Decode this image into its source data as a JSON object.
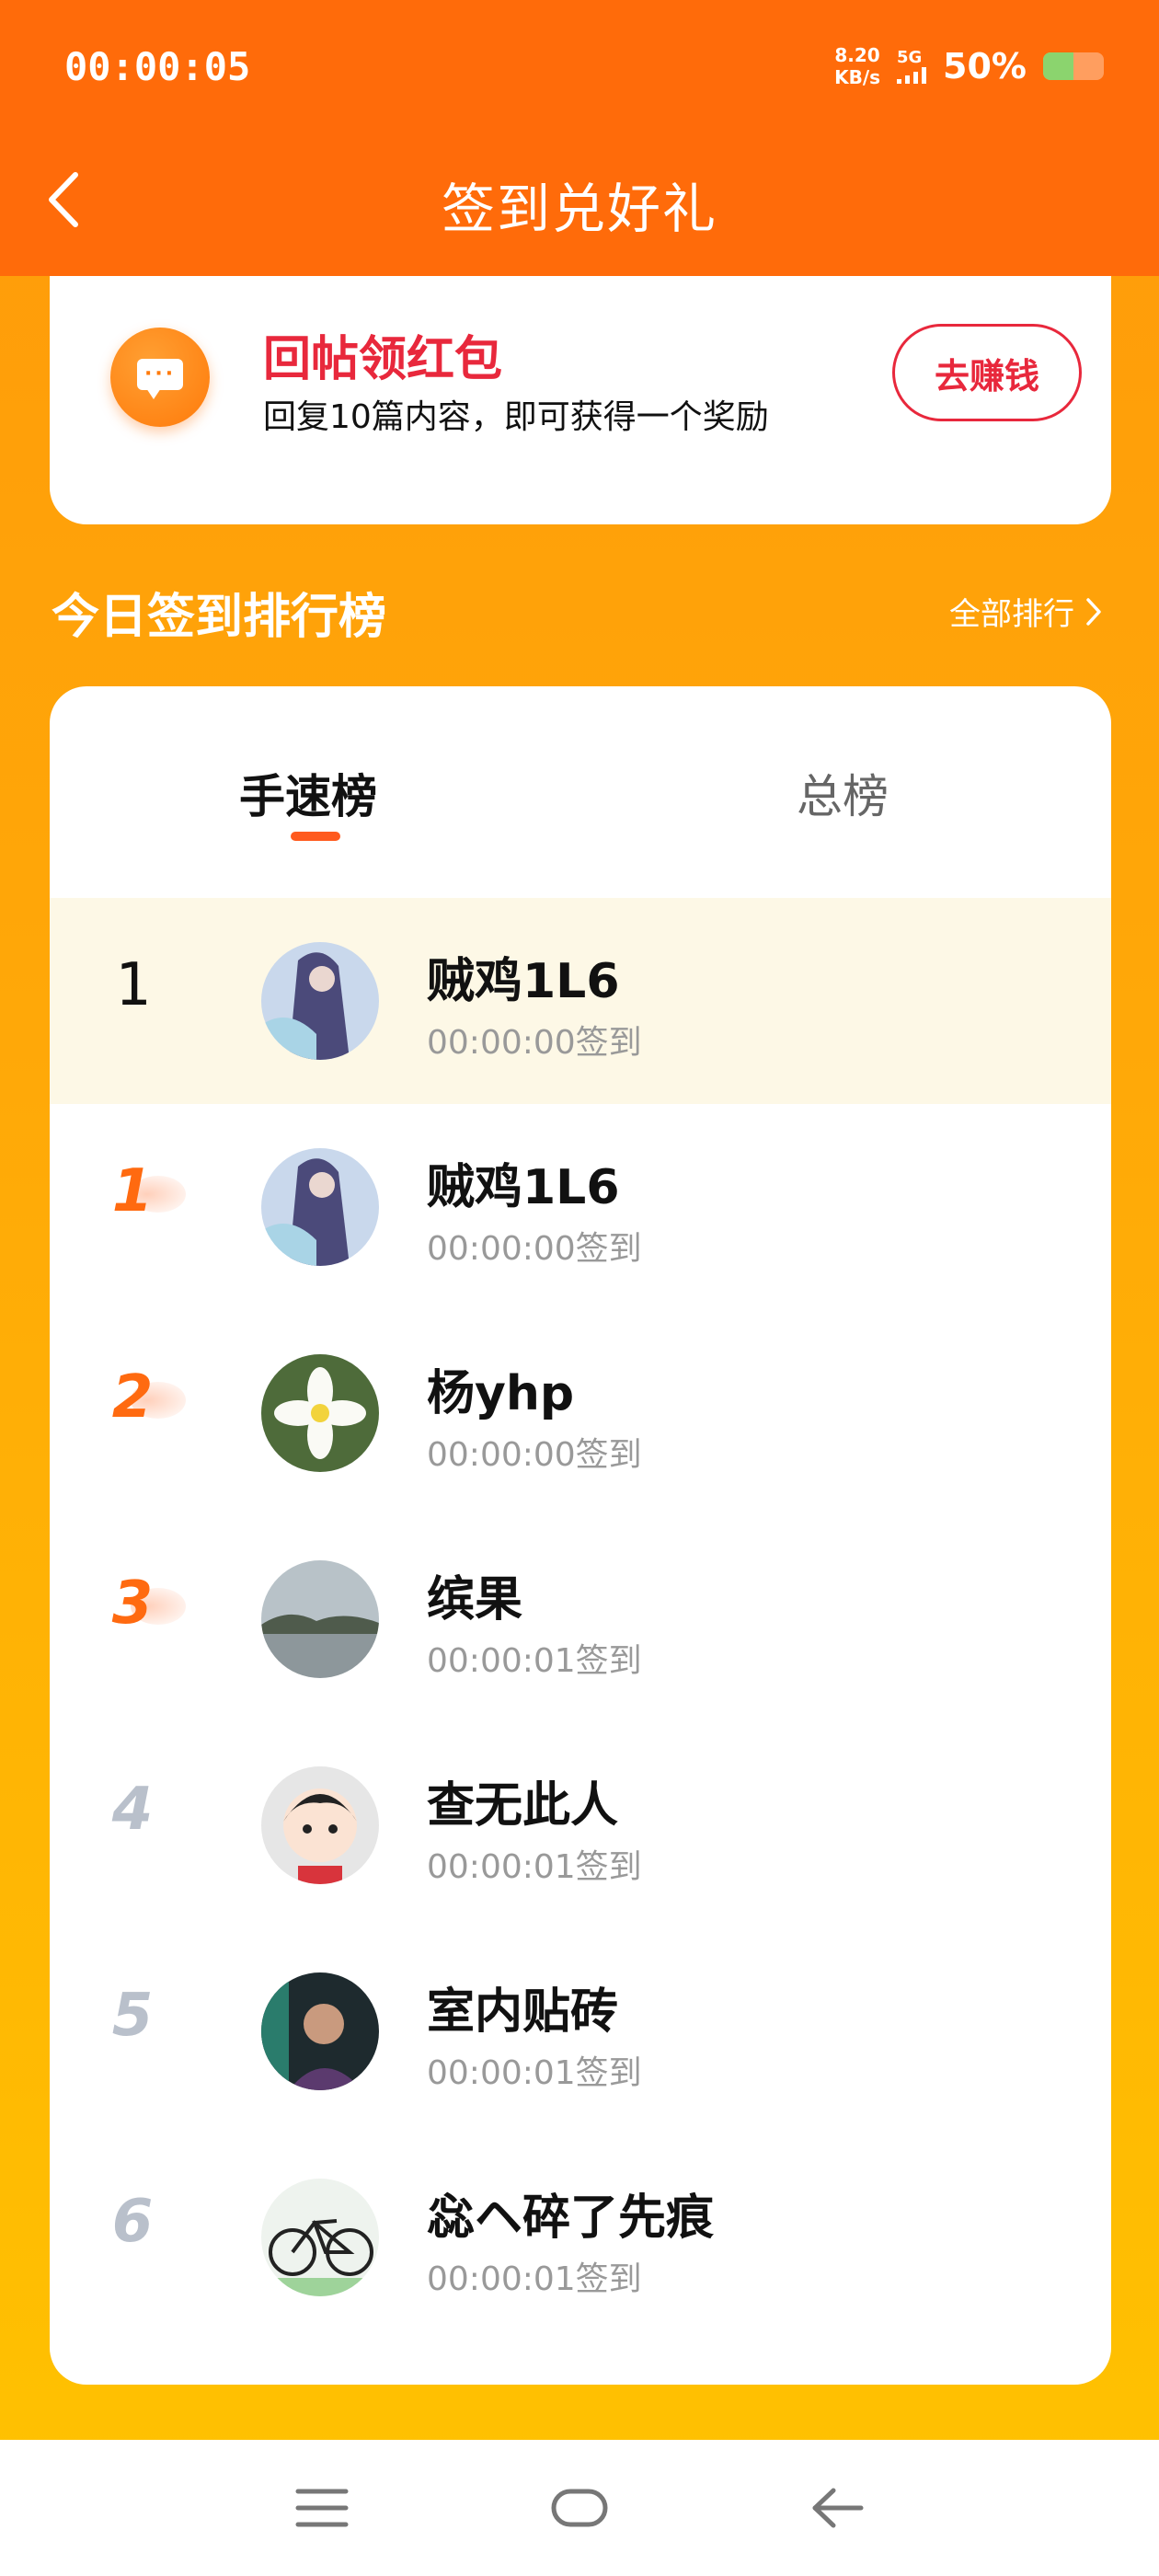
{
  "status_bar": {
    "time": "00:00:05",
    "net_speed_value": "8.20",
    "net_speed_unit": "KB/s",
    "network": "5G",
    "battery_percent": "50%",
    "battery_level": 0.5
  },
  "header": {
    "title": "签到兑好礼"
  },
  "promo": {
    "title": "回帖领红包",
    "description": "回复10篇内容，即可获得一个奖励",
    "button": "去赚钱"
  },
  "ranking": {
    "section_title": "今日签到排行榜",
    "all_link": "全部排行",
    "tabs": [
      {
        "label": "手速榜",
        "active": true
      },
      {
        "label": "总榜",
        "active": false
      }
    ],
    "rows": [
      {
        "rank": "1",
        "name": "贼鸡1L6",
        "time": "00:00:00签到",
        "avatar": "anime-girl-avatar",
        "me": true
      },
      {
        "rank": "1",
        "name": "贼鸡1L6",
        "time": "00:00:00签到",
        "avatar": "anime-girl-avatar"
      },
      {
        "rank": "2",
        "name": "杨yhp",
        "time": "00:00:00签到",
        "avatar": "white-flower-avatar"
      },
      {
        "rank": "3",
        "name": "缤果",
        "time": "00:00:01签到",
        "avatar": "lake-landscape-avatar"
      },
      {
        "rank": "4",
        "name": "查无此人",
        "time": "00:00:01签到",
        "avatar": "cartoon-kid-avatar"
      },
      {
        "rank": "5",
        "name": "室内贴砖",
        "time": "00:00:01签到",
        "avatar": "man-portrait-avatar"
      },
      {
        "rank": "6",
        "name": "惢ヘ碎了先痕",
        "time": "00:00:01签到",
        "avatar": "bicycle-avatar"
      }
    ]
  },
  "nav_bar": {
    "icons": [
      "menu-icon",
      "home-icon",
      "back-icon"
    ]
  },
  "colors": {
    "header": "#FF6B0A",
    "accent_red": "#E8283C",
    "medal_orange": "#FF6A10"
  }
}
